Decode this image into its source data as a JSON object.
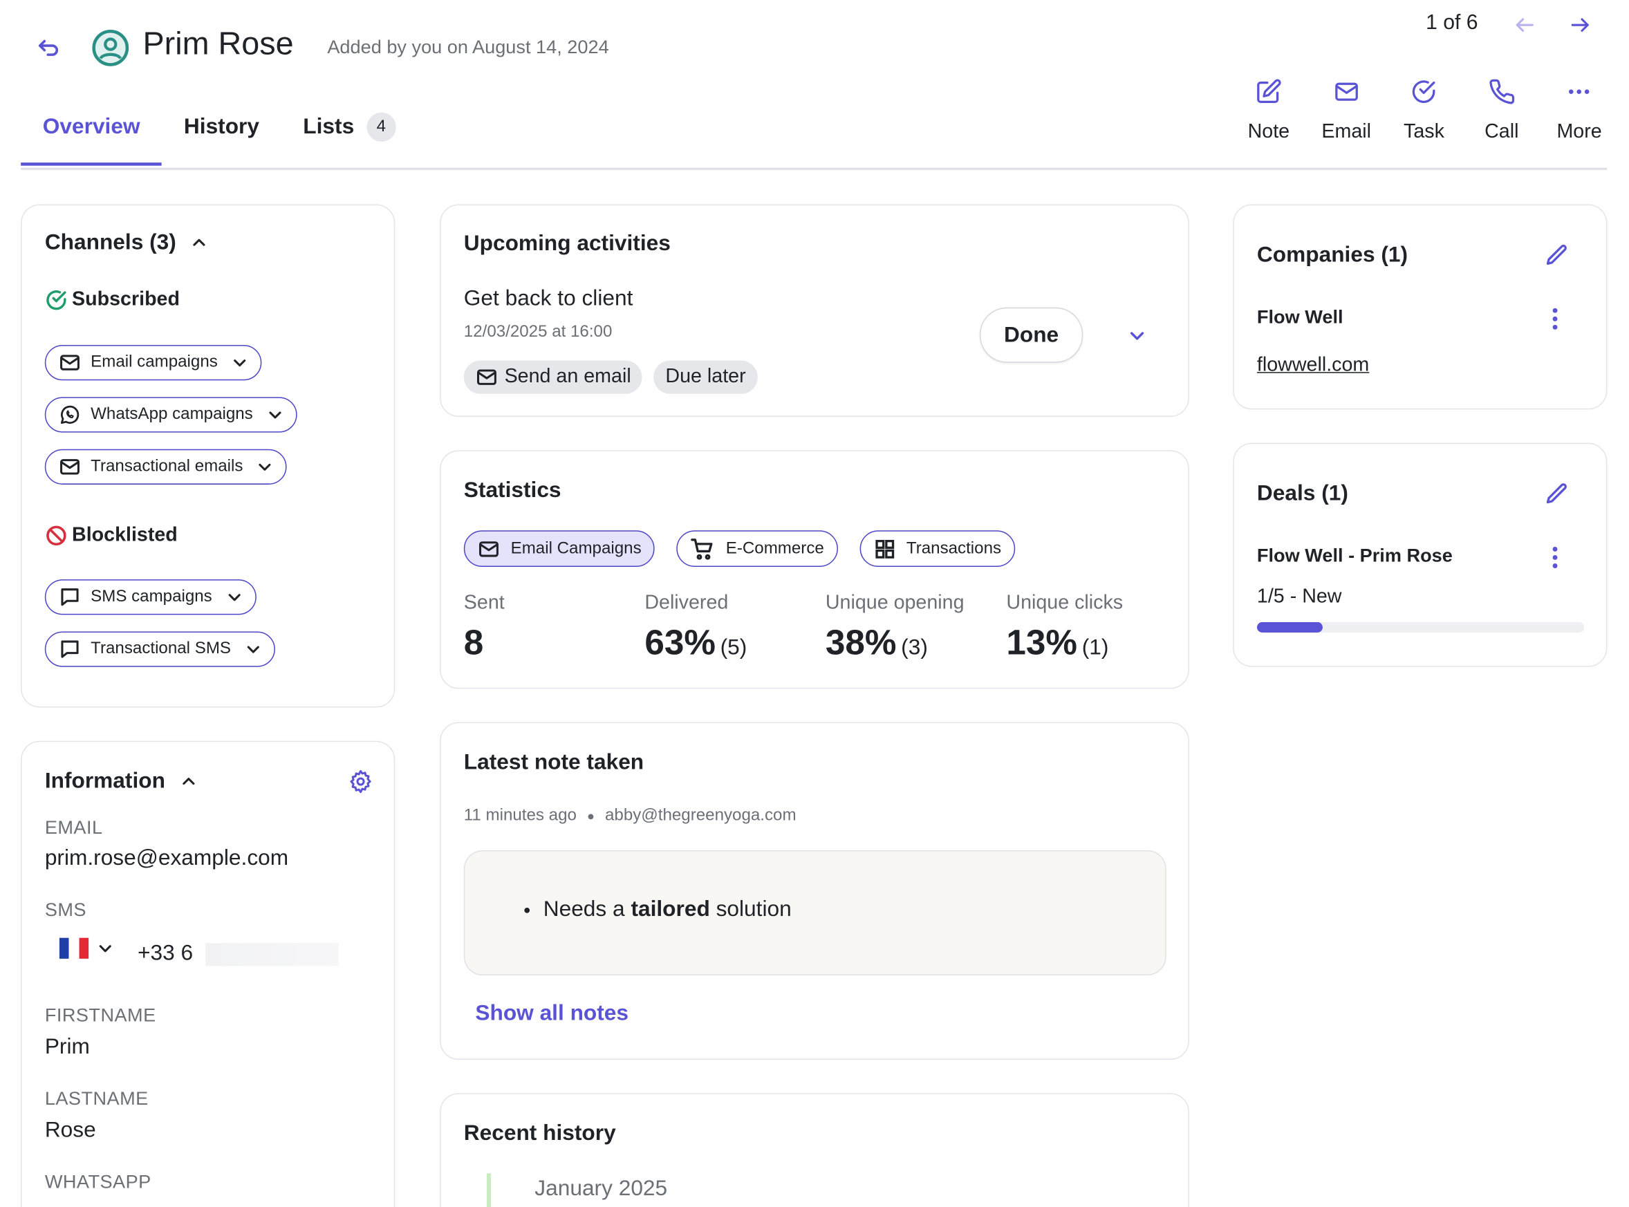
{
  "header": {
    "contact_name": "Prim Rose",
    "added_text": "Added by you on August 14, 2024",
    "pager": "1 of 6"
  },
  "actions": [
    {
      "label": "Note",
      "icon": "note-edit-icon"
    },
    {
      "label": "Email",
      "icon": "envelope-icon"
    },
    {
      "label": "Task",
      "icon": "task-check-icon"
    },
    {
      "label": "Call",
      "icon": "phone-icon"
    },
    {
      "label": "More",
      "icon": "ellipsis-icon"
    }
  ],
  "tabs": [
    {
      "label": "Overview",
      "active": true
    },
    {
      "label": "History",
      "active": false
    },
    {
      "label": "Lists",
      "active": false,
      "count": "4"
    }
  ],
  "channels": {
    "title": "Channels (3)",
    "subscribed_label": "Subscribed",
    "subscribed": [
      "Email campaigns",
      "WhatsApp campaigns",
      "Transactional emails"
    ],
    "blocklisted_label": "Blocklisted",
    "blocklisted": [
      "SMS campaigns",
      "Transactional SMS"
    ]
  },
  "information": {
    "title": "Information",
    "email_label": "EMAIL",
    "email": "prim.rose@example.com",
    "sms_label": "SMS",
    "sms_prefix": "+33 6",
    "firstname_label": "FIRSTNAME",
    "firstname": "Prim",
    "lastname_label": "LASTNAME",
    "lastname": "Rose",
    "whatsapp_label": "WHATSAPP"
  },
  "upcoming": {
    "title": "Upcoming activities",
    "activity_title": "Get back to client",
    "activity_date": "12/03/2025 at 16:00",
    "tag_send_email": "Send an email",
    "tag_due": "Due later",
    "done_label": "Done"
  },
  "statistics": {
    "title": "Statistics",
    "filters": [
      {
        "label": "Email Campaigns",
        "selected": true
      },
      {
        "label": "E-Commerce",
        "selected": false
      },
      {
        "label": "Transactions",
        "selected": false
      }
    ],
    "metrics": [
      {
        "label": "Sent",
        "value": "8",
        "sub": ""
      },
      {
        "label": "Delivered",
        "value": "63%",
        "sub": "(5)"
      },
      {
        "label": "Unique opening",
        "value": "38%",
        "sub": "(3)"
      },
      {
        "label": "Unique clicks",
        "value": "13%",
        "sub": "(1)"
      }
    ]
  },
  "latest_note": {
    "title": "Latest note taken",
    "time": "11 minutes ago",
    "author": "abby@thegreenyoga.com",
    "note_pre": "Needs a ",
    "note_bold": "tailored",
    "note_post": " solution",
    "show_all": "Show all notes"
  },
  "recent_history": {
    "title": "Recent history",
    "month": "January 2025"
  },
  "companies": {
    "title": "Companies (1)",
    "name": "Flow Well",
    "domain": "flowwell.com"
  },
  "deals": {
    "title": "Deals (1)",
    "name": "Flow Well - Prim Rose",
    "stage": "1/5 - New",
    "progress": 0.2
  },
  "colors": {
    "accent": "#5a53d6",
    "subscribed": "#1f9d6b",
    "blocklisted": "#d6303f",
    "history_line": "#c9ecc0"
  }
}
